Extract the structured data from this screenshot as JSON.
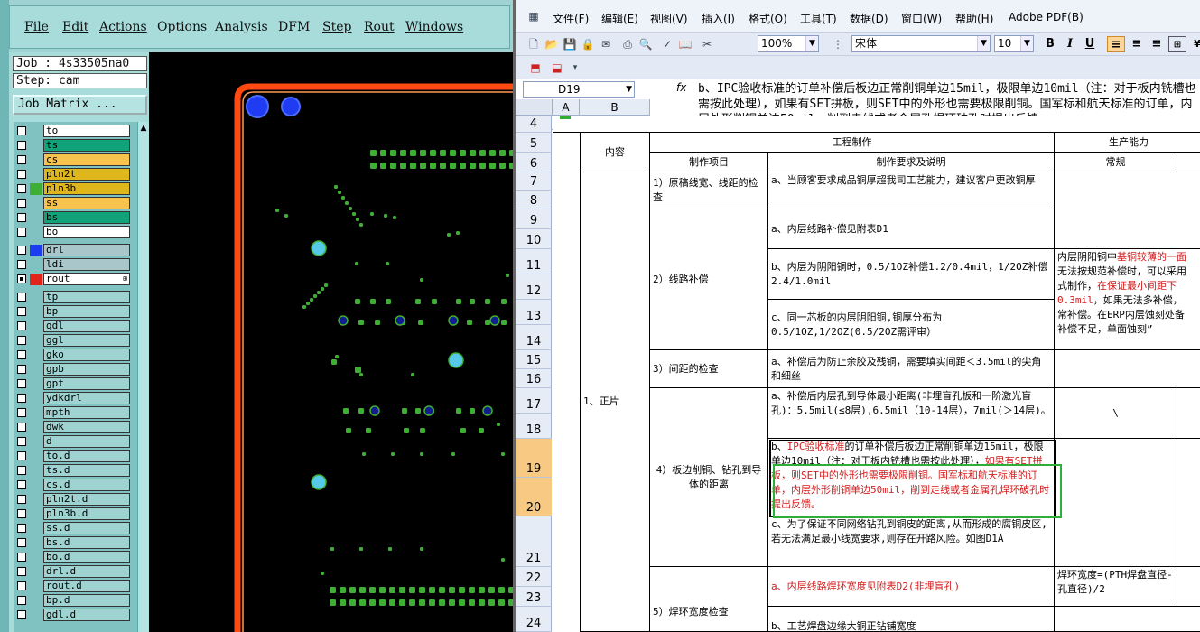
{
  "cam": {
    "menus": [
      {
        "label": "File",
        "u": true
      },
      {
        "label": "Edit",
        "u": true
      },
      {
        "label": "Actions",
        "u": true
      },
      {
        "label": "Options",
        "u": false
      },
      {
        "label": "Analysis",
        "u": false
      },
      {
        "label": "DFM",
        "u": false
      },
      {
        "label": "Step",
        "u": true
      },
      {
        "label": "Rout",
        "u": true
      },
      {
        "label": "Windows",
        "u": true
      }
    ],
    "job": "Job : 4s33505na0",
    "step": "Step: cam",
    "job_matrix": "Job Matrix ...",
    "layers": [
      {
        "name": "to",
        "color": "#ffffff",
        "sw": "",
        "on": false
      },
      {
        "name": "ts",
        "color": "#10a278",
        "sw": "",
        "on": false
      },
      {
        "name": "cs",
        "color": "#f7c24d",
        "sw": "",
        "on": false
      },
      {
        "name": "pln2t",
        "color": "#e0b61d",
        "sw": "",
        "on": false
      },
      {
        "name": "pln3b",
        "color": "#e0b61d",
        "sw": "#3fae34",
        "on": false
      },
      {
        "name": "ss",
        "color": "#f7c24d",
        "sw": "",
        "on": false
      },
      {
        "name": "bs",
        "color": "#10a278",
        "sw": "",
        "on": false
      },
      {
        "name": "bo",
        "color": "#ffffff",
        "sw": "",
        "on": false
      },
      {
        "name": "drl",
        "color": "#a9c7cb",
        "sw": "#1c3cf0",
        "on": false,
        "gap": true
      },
      {
        "name": "ldi",
        "color": "#a9c7cb",
        "sw": "",
        "on": false
      },
      {
        "name": "rout",
        "color": "#ffffff",
        "sw": "#e2231a",
        "on": true,
        "mark": "⊞"
      },
      {
        "name": "tp",
        "color": "#9ed3d2",
        "sw": "",
        "on": false,
        "gap": true
      },
      {
        "name": "bp",
        "color": "#9ed3d2",
        "sw": "",
        "on": false
      },
      {
        "name": "gdl",
        "color": "#9ed3d2",
        "sw": "",
        "on": false
      },
      {
        "name": "ggl",
        "color": "#9ed3d2",
        "sw": "",
        "on": false
      },
      {
        "name": "gko",
        "color": "#9ed3d2",
        "sw": "",
        "on": false
      },
      {
        "name": "gpb",
        "color": "#9ed3d2",
        "sw": "",
        "on": false
      },
      {
        "name": "gpt",
        "color": "#9ed3d2",
        "sw": "",
        "on": false
      },
      {
        "name": "ydkdrl",
        "color": "#9ed3d2",
        "sw": "",
        "on": false
      },
      {
        "name": "mpth",
        "color": "#9ed3d2",
        "sw": "",
        "on": false
      },
      {
        "name": "dwk",
        "color": "#9ed3d2",
        "sw": "",
        "on": false
      },
      {
        "name": "d",
        "color": "#9ed3d2",
        "sw": "",
        "on": false
      },
      {
        "name": "to.d",
        "color": "#9ed3d2",
        "sw": "",
        "on": false
      },
      {
        "name": "ts.d",
        "color": "#9ed3d2",
        "sw": "",
        "on": false
      },
      {
        "name": "cs.d",
        "color": "#9ed3d2",
        "sw": "",
        "on": false
      },
      {
        "name": "pln2t.d",
        "color": "#9ed3d2",
        "sw": "",
        "on": false
      },
      {
        "name": "pln3b.d",
        "color": "#9ed3d2",
        "sw": "",
        "on": false
      },
      {
        "name": "ss.d",
        "color": "#9ed3d2",
        "sw": "",
        "on": false
      },
      {
        "name": "bs.d",
        "color": "#9ed3d2",
        "sw": "",
        "on": false
      },
      {
        "name": "bo.d",
        "color": "#9ed3d2",
        "sw": "",
        "on": false
      },
      {
        "name": "drl.d",
        "color": "#9ed3d2",
        "sw": "",
        "on": false
      },
      {
        "name": "rout.d",
        "color": "#9ed3d2",
        "sw": "",
        "on": false
      },
      {
        "name": "bp.d",
        "color": "#9ed3d2",
        "sw": "",
        "on": false
      },
      {
        "name": "gdl.d",
        "color": "#9ed3d2",
        "sw": "",
        "on": false
      }
    ]
  },
  "excel": {
    "menus": [
      "文件(F)",
      "编辑(E)",
      "视图(V)",
      "插入(I)",
      "格式(O)",
      "工具(T)",
      "数据(D)",
      "窗口(W)",
      "帮助(H)",
      "Adobe PDF(B)"
    ],
    "zoom": "100%",
    "font": "宋体",
    "font_size": "10",
    "name_box": "D19",
    "fx": "fx",
    "formula": "b、IPC验收标准的订单补偿后板边正常削铜单边15mil，极限单边10mil（注：对于板内铣槽也需按此处理），如果有SET拼板，则SET中的外形也需要极限削铜。国军标和航天标准的订单，内层外形削铜单边50mil，削到走线或者金属孔焊环破孔时提出反馈。",
    "col_a": "A",
    "col_b": "B",
    "rows": [
      "4",
      "5",
      "6",
      "7",
      "8",
      "9",
      "10",
      "11",
      "12",
      "13",
      "14",
      "15",
      "16",
      "17",
      "18",
      "19",
      "20",
      "21",
      "22",
      "23",
      "24"
    ],
    "header": {
      "content": "内容",
      "eng": "工程制作",
      "capability": "生产能力",
      "item": "制作项目",
      "req": "制作要求及说明",
      "normal": "常规"
    },
    "cat_positive": "1、正片",
    "items": {
      "i1": "1）原稿线宽、线距的检查",
      "i2": "2）线路补偿",
      "i3": "3）间距的检查",
      "i4": "4）板边削铜、钻孔到导体的距离",
      "i5": "5）焊环宽度检查"
    },
    "req": {
      "r7": "a、当顾客要求成品铜厚超我司工艺能力，建议客户更改铜厚",
      "r9": "a、内层线路补偿见附表D1",
      "r11": "b、内层为阴阳铜时，0.5/1OZ补偿1.2/0.4mil，1/2OZ补偿2.4/1.0mil",
      "r13": "c、同一芯板的内层阴阳铜,铜厚分布为0.5/1OZ,1/2OZ(0.5/2OZ需评审）",
      "r15": "a、补偿后为防止余胶及残铜，需要填实间距＜3.5mil的尖角和细丝",
      "r17": "a、补偿后内层孔到导体最小距离(非埋盲孔板和一阶激光盲孔)：5.5mil(≤8层),6.5mil（10-14层），7mil(＞14层)。",
      "r19_a": "b、",
      "r19_red1": "IPC验收标准",
      "r19_b": "的订单补偿后板边正常削铜单边15mil，极限单边10mil（注：对于板内铣槽也需按此处理），",
      "r19_red2": "如果有SET拼板，则SET中的外形也需要极限削铜。国军标和航天标准的订单，内层外形削铜单边50mil，削到走线或者金属孔焊环破孔时提出反馈。",
      "r21": "c、为了保证不同网络钻孔到铜皮的距离,从而形成的腐铜皮区,若无法满足最小线宽要求,则存在开路风险。如图D1A",
      "r22": "a、内层线路焊环宽度见附表D2(非埋盲孔)",
      "r24": "b、工艺焊盘边缘大铜正钻铺宽度"
    },
    "cap": {
      "c11_a": "内层阴阳铜中",
      "c11_red1": "基铜较薄的一面",
      "c11_b": "无法按规范补偿时，可以采用",
      "c11_c": "式制作，",
      "c11_red2": "在保证最小间距下",
      "c11_red3": "0.3mil",
      "c11_d": "，如果无法多补偿，",
      "c11_e": "常补偿。在ERP内层蚀刻处备",
      "c11_f": "补偿不足，单面蚀刻”",
      "c17": "\\",
      "c22": "焊环宽度=(PTH焊盘直径-孔直径)/2"
    }
  }
}
